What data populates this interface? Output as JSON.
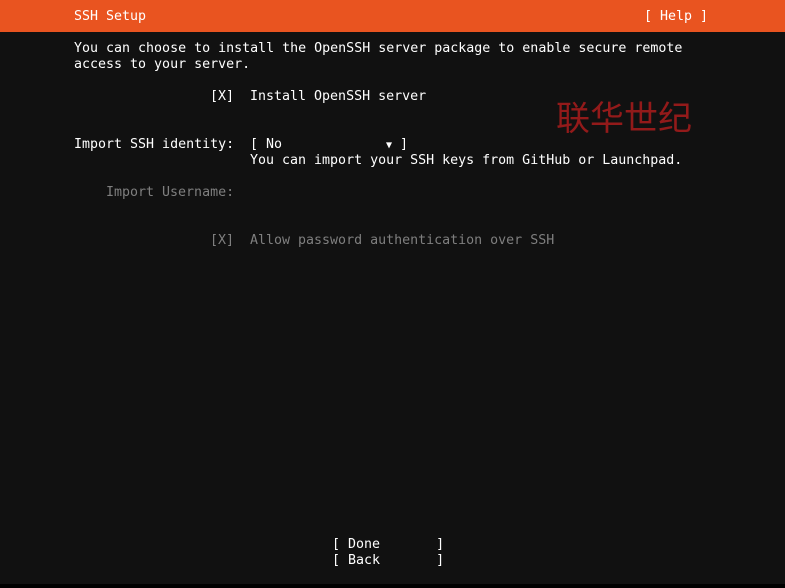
{
  "header": {
    "title": "SSH Setup",
    "help_label": "[ Help ]"
  },
  "intro": {
    "line1": "You can choose to install the OpenSSH server package to enable secure remote",
    "line2": "access to your server."
  },
  "install_openssh": {
    "checkbox": "[X]",
    "label": "Install OpenSSH server"
  },
  "import_identity": {
    "label": "Import SSH identity:",
    "select_open": "[ No",
    "select_arrow": "▼",
    "select_close": "]",
    "help": "You can import your SSH keys from GitHub or Launchpad."
  },
  "import_username": {
    "label": "Import Username:"
  },
  "allow_password": {
    "checkbox": "[X]",
    "label": "Allow password authentication over SSH"
  },
  "buttons": {
    "done": "[ Done       ]",
    "back": "[ Back       ]"
  },
  "watermark": "联华世纪",
  "colors": {
    "accent": "#e95420",
    "background": "#111111",
    "text": "#ffffff",
    "disabled_text": "#7f7f7f",
    "watermark": "#9a1b1b"
  }
}
